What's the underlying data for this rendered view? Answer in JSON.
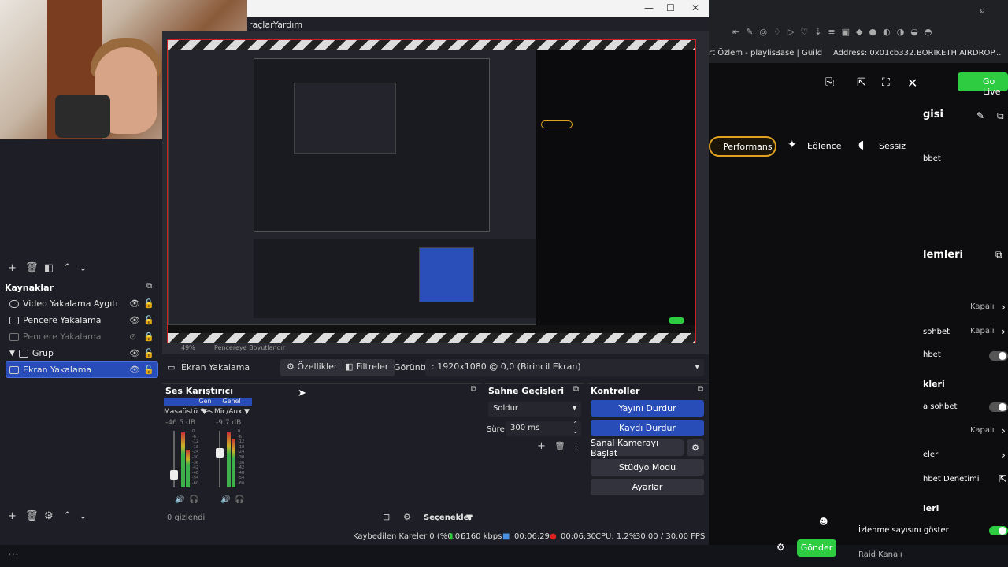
{
  "window": {
    "controls": [
      "—",
      "☐",
      "✕"
    ]
  },
  "menu": {
    "items": [
      "raçlar",
      "Yardım"
    ]
  },
  "sources": {
    "title": "Kaynaklar",
    "items": [
      {
        "label": "Video Yakalama Aygıtı"
      },
      {
        "label": "Pencere Yakalama"
      },
      {
        "label": "Pencere Yakalama"
      },
      {
        "label": "Grup"
      },
      {
        "label": "Ekran Yakalama"
      }
    ]
  },
  "preview": {
    "zoom_label": "49%",
    "resize_label": "Pencereye Boyutlandır"
  },
  "properties_bar": {
    "source_name": "Ekran Yakalama",
    "properties_button": "Özellikler",
    "filters_button": "Filtreler",
    "display_label": "Görüntü",
    "display_value": ": 1920x1080 @ 0,0 (Birincil Ekran)"
  },
  "mixer": {
    "title": "Ses Karıştırıcı",
    "channels": [
      {
        "group": "Genel",
        "name": "Masaüstü Ses",
        "db": "-46.5 dB"
      },
      {
        "group": "Genel",
        "name": "Mic/Aux",
        "db": "-9.7 dB"
      }
    ],
    "scale": [
      "0",
      "-6",
      "-12",
      "-18",
      "-24",
      "-30",
      "-36",
      "-42",
      "-48",
      "-54",
      "-60"
    ],
    "hidden_label": "0 gizlendi",
    "options_label": "Seçenekler"
  },
  "transitions": {
    "title": "Sahne Geçişleri",
    "selected": "Soldur",
    "duration_label": "Süre",
    "duration_value": "300 ms"
  },
  "controls": {
    "title": "Kontroller",
    "buttons": [
      "Yayını Durdur",
      "Kaydı Durdur",
      "Sanal Kamerayı Başlat",
      "Stüdyo Modu",
      "Ayarlar"
    ]
  },
  "status": {
    "dropped_frames": "Kaybedilen Kareler 0 (%0.0)",
    "bitrate": "6160 kbps",
    "stream_time": "00:06:29",
    "record_time": "00:06:30",
    "cpu": "CPU: 1.2%",
    "fps": "30.00 / 30.00 FPS"
  },
  "browser": {
    "bookmarks": [
      "rt Özlem - playlis...",
      "Base | Guild",
      "Address: 0x01cb332...",
      "BORIKETH AIRDROP..."
    ],
    "go_live_label": "Go Live",
    "heading_partial": "gisi",
    "sohbet_partial": "bbet",
    "modes": [
      "Performans",
      "Eğlence",
      "Sessiz"
    ],
    "section_elemleri": "lemleri",
    "kapali_labels": [
      "Kapalı",
      "Kapalı",
      "Kapalı"
    ],
    "rows": [
      "sohbet",
      "hbet",
      "kleri",
      "a sohbet",
      "eler",
      "hbet Denetimi",
      "leri"
    ],
    "show_viewers_label": "İzlenme sayısını göster",
    "send_label": "Gönder",
    "raid_label": "Raid Kanalı"
  },
  "colors": {
    "accent_blue": "#284cb8",
    "live_green": "#2ecc40",
    "record_red": "#e02020",
    "performans_gold": "#e0a020"
  }
}
